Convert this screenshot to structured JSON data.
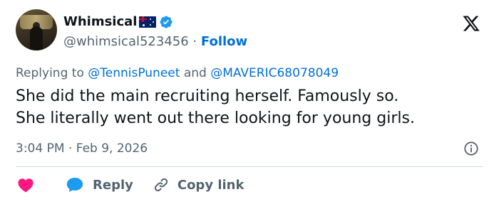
{
  "author": {
    "display_name": "Whimsical",
    "handle": "@whimsical523456",
    "separator": "·",
    "follow_label": "Follow"
  },
  "reply_context": {
    "prefix": "Replying to",
    "mention_1": "@TennisPuneet",
    "conjunction": "and",
    "mention_2": "@MAVERIC68078049"
  },
  "tweet": {
    "line_1": "She did the main recruiting herself. Famously so.",
    "line_2": "She literally went out there looking for young girls."
  },
  "meta": {
    "time": "3:04 PM",
    "separator": "·",
    "date": "Feb 9, 2026"
  },
  "actions": {
    "reply_label": "Reply",
    "copy_link_label": "Copy link"
  },
  "icons": {
    "flag": "australia-flag-icon",
    "verified": "verified-badge-icon",
    "logo": "x-logo-icon",
    "info": "info-icon",
    "like": "heart-icon",
    "reply": "speech-bubble-icon",
    "link": "link-icon"
  },
  "colors": {
    "link_blue": "#006fd6",
    "verified_blue": "#1d9bf0",
    "heart_pink": "#f91880",
    "muted_text": "#536471",
    "text": "#0f1419",
    "divider": "#cfd9de"
  }
}
